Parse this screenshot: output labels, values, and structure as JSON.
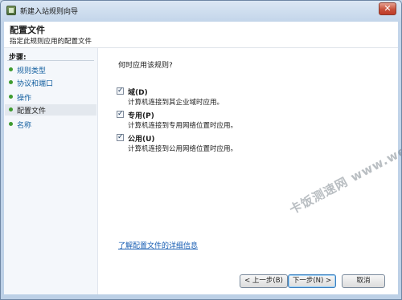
{
  "window": {
    "title": "新建入站规则向导",
    "close_label": "✕"
  },
  "header": {
    "title": "配置文件",
    "subtitle": "指定此规则应用的配置文件"
  },
  "steps": {
    "title": "步骤:",
    "items": [
      {
        "label": "规则类型"
      },
      {
        "label": "协议和端口"
      },
      {
        "label": "操作"
      },
      {
        "label": "配置文件"
      },
      {
        "label": "名称"
      }
    ]
  },
  "content": {
    "question": "何时应用该规则?",
    "options": [
      {
        "label": "域(D)",
        "description": "计算机连接到其企业域时应用。",
        "checked": true,
        "mark": "✓"
      },
      {
        "label": "专用(P)",
        "description": "计算机连接到专用网络位置时应用。",
        "checked": true,
        "mark": "✓"
      },
      {
        "label": "公用(U)",
        "description": "计算机连接到公用网络位置时应用。",
        "checked": true,
        "mark": "✓"
      }
    ],
    "learn_more": "了解配置文件的详细信息"
  },
  "buttons": {
    "back": "< 上一步(B)",
    "next": "下一步(N) >",
    "cancel": "取消"
  },
  "watermark": "卡饭测速网 www.webkaka.com"
}
